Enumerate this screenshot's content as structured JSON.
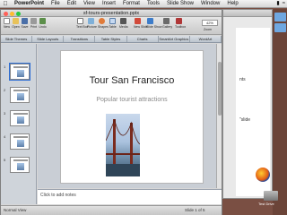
{
  "menubar": {
    "app": "PowerPoint",
    "items": [
      "File",
      "Edit",
      "View",
      "Insert",
      "Format",
      "Tools",
      "Slide Show",
      "Window",
      "Help"
    ]
  },
  "window": {
    "title": "sf-tours-presentation.pptx"
  },
  "toolbar": {
    "buttons": [
      "New",
      "Open",
      "Save",
      "Print",
      "Undo",
      "Text Box",
      "Picture",
      "Shapes",
      "Table",
      "Media",
      "New Slide",
      "Slide Show",
      "Gallery",
      "Toolbox"
    ],
    "zoom_value": "42%",
    "zoom_label": "Zoom"
  },
  "ribbon": {
    "tabs": [
      "Slide Themes",
      "Slide Layouts",
      "Transitions",
      "Table Styles",
      "Charts",
      "SmartArt Graphics",
      "WordArt"
    ]
  },
  "thumbnails": [
    "1",
    "2",
    "3",
    "4",
    "5"
  ],
  "slide": {
    "title": "Tour San Francisco",
    "subtitle": "Popular tourist attractions"
  },
  "notes": {
    "placeholder": "Click to add notes"
  },
  "status": {
    "view": "Normal View",
    "page": "Slide 1 of 5"
  },
  "background_window": {
    "snippet_1": "nts",
    "snippet_2": "\"slide"
  },
  "desktop": {
    "firefox_label": "Firefox",
    "drive_label": "Test Drive"
  },
  "colors": {
    "selection": "#2e6fd6",
    "desktop": "#7a4f43"
  }
}
